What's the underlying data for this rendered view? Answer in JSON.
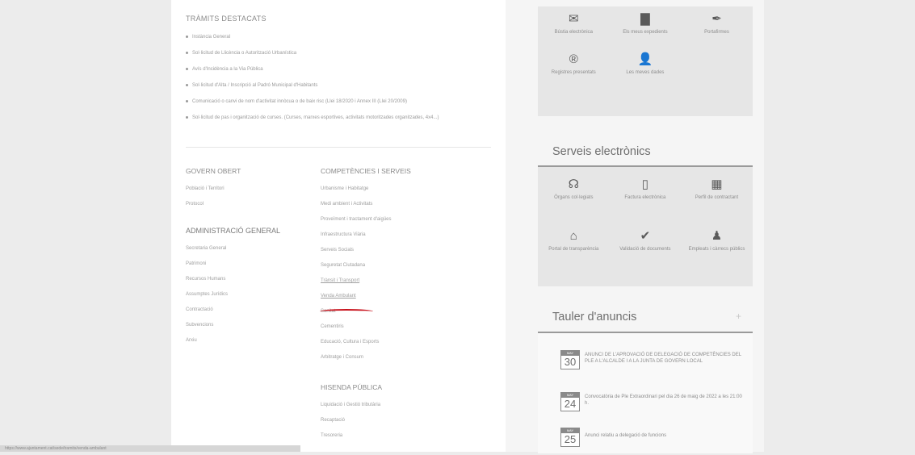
{
  "tramits": {
    "title": "TRÀMITS DESTACATS",
    "items": [
      "Instància General",
      "Sol·licitud de Llicència o Autorització Urbanística",
      "Avís d'Incidència a la Via Pública",
      "Sol·licitud d'Alta / Inscripció al Padró Municipal d'Habitants",
      "Comunicació o canvi de nom d'activitat innòcua o de baix risc (Llei 18/2020 i Annex III (Llei 20/2009)",
      "Sol·licitud de pas i organització de curses. (Curses, marxes esportives, activitats motoritzades organitzades, 4x4...)"
    ]
  },
  "govern_obert": {
    "title": "GOVERN OBERT",
    "links": [
      "Població i Territori",
      "Protocol"
    ]
  },
  "administracio": {
    "title": "ADMINISTRACIÓ GENERAL",
    "links": [
      "Secretaria General",
      "Patrimoni",
      "Recursos Humans",
      "Assumptes Jurídics",
      "Contractació",
      "Subvencions",
      "Arxiu"
    ]
  },
  "competencies": {
    "title": "COMPETÈNCIES I SERVEIS",
    "links": [
      "Urbanisme i Habitatge",
      "Medi ambient i Activitats",
      "Proveïment i tractament d'aigües",
      "Infraestructura Viària",
      "Serveis Socials",
      "Seguretat Ciutadana",
      "Trànsit i Transport",
      "Venda Ambulant",
      "Sanitat",
      "Cementiris",
      "Educació, Cultura i Esports",
      "Arbitratge i Consum"
    ]
  },
  "hisenda": {
    "title": "HISENDA PÚBLICA",
    "links": [
      "Liquidació i Gestió tributària",
      "Recaptació",
      "Tresoreria"
    ]
  },
  "top_card": {
    "tiles": [
      {
        "icon": "envelope-icon",
        "glyph": "✉",
        "label": "Bústia electrònica"
      },
      {
        "icon": "folder-icon",
        "glyph": "▇",
        "label": "Els meus expedients"
      },
      {
        "icon": "quill-icon",
        "glyph": "✒",
        "label": "Portafirmes"
      },
      {
        "icon": "registered-icon",
        "glyph": "®",
        "label": "Registres presentats"
      },
      {
        "icon": "user-icon",
        "glyph": "👤",
        "label": "Les meves dades"
      }
    ]
  },
  "serveis": {
    "title": "Serveis electrònics",
    "tiles": [
      {
        "icon": "broadcast-icon",
        "glyph": "☊",
        "label": "Òrgans col·legiats"
      },
      {
        "icon": "document-icon",
        "glyph": "▯",
        "label": "Factura electrònica"
      },
      {
        "icon": "briefcase-icon",
        "glyph": "▦",
        "label": "Perfil de contractant"
      },
      {
        "icon": "institution-icon",
        "glyph": "⌂",
        "label": "Portal de transparència"
      },
      {
        "icon": "check-icon",
        "glyph": "✔",
        "label": "Validació de documents"
      },
      {
        "icon": "employees-icon",
        "glyph": "♟",
        "label": "Empleats i càrrecs públics"
      }
    ]
  },
  "tauler": {
    "title": "Tauler d'anuncis",
    "plus": "+",
    "notices": [
      {
        "month": "MAY",
        "day": "30",
        "text": "ANUNCI DE L'APROVACIÓ DE DELEGACIÓ DE COMPETÈNCIES DEL PLE A L'ALCALDE I A LA JUNTA DE GOVERN LOCAL"
      },
      {
        "month": "MAY",
        "day": "24",
        "text": "Convocatòria de Ple Extraordinari pel dia 26 de maig de 2022 a les 21:00 h."
      },
      {
        "month": "MAY",
        "day": "25",
        "text": "Anunci relatiu a delegació de funcions"
      }
    ]
  },
  "status_bar": {
    "text": "https://www.ajuntament.cat/sede/tramits/venda-ambulant"
  },
  "colors": {
    "accent_underline": "#c8141e",
    "card_bg": "#e6e6e6"
  }
}
